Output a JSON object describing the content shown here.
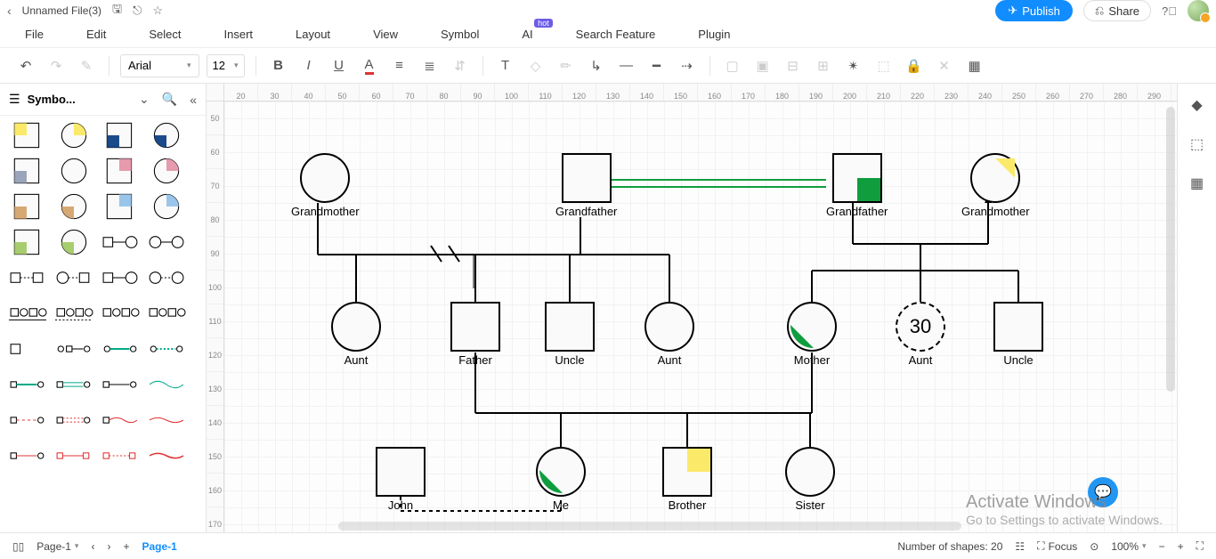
{
  "titlebar": {
    "filename": "Unnamed File(3)",
    "publish": "Publish",
    "share": "Share"
  },
  "menus": [
    "File",
    "Edit",
    "Select",
    "Insert",
    "Layout",
    "View",
    "Symbol",
    "AI",
    "Search Feature",
    "Plugin"
  ],
  "ai_badge": "hot",
  "toolbar": {
    "font": "Arial",
    "size": "12"
  },
  "panel": {
    "title": "Symbo..."
  },
  "ruler_h": [
    "20",
    "30",
    "40",
    "50",
    "60",
    "70",
    "80",
    "90",
    "100",
    "110",
    "120",
    "130",
    "140",
    "150",
    "160",
    "170",
    "180",
    "190",
    "200",
    "210",
    "220",
    "230",
    "240",
    "250",
    "260",
    "270",
    "280",
    "290"
  ],
  "ruler_v": [
    "50",
    "60",
    "70",
    "80",
    "90",
    "100",
    "110",
    "120",
    "130",
    "140",
    "150",
    "160",
    "170"
  ],
  "nodes": {
    "gm1": "Grandmother",
    "gf1": "Grandfather",
    "gf2": "Grandfather",
    "gm2": "Grandmother",
    "aunt1": "Aunt",
    "father": "Father",
    "uncle1": "Uncle",
    "aunt2": "Aunt",
    "mother": "Mother",
    "aunt3": "Aunt",
    "aunt3_age": "30",
    "uncle2": "Uncle",
    "john": "John",
    "me": "Me",
    "brother": "Brother",
    "sister": "Sister"
  },
  "status": {
    "page_sel": "Page-1",
    "page_tab": "Page-1",
    "shapes_label": "Number of shapes: 20",
    "focus": "Focus",
    "zoom": "100%"
  },
  "watermark": {
    "l1": "Activate Windows",
    "l2": "Go to Settings to activate Windows."
  }
}
